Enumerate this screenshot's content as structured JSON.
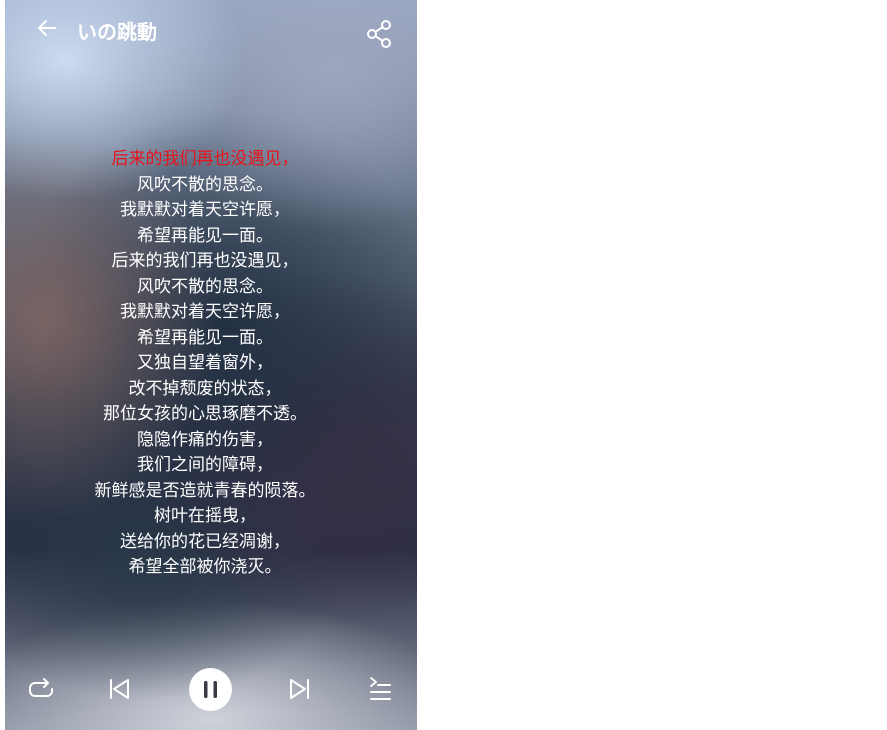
{
  "app": {
    "song_title": "いの跳動"
  },
  "header": {
    "back_icon": "arrow-left-icon",
    "share_icon": "share-icon"
  },
  "lyrics": {
    "active_index": 0,
    "lines": [
      "后来的我们再也没遇见，",
      "风吹不散的思念。",
      "我默默对着天空许愿，",
      "希望再能见一面。",
      "后来的我们再也没遇见，",
      "风吹不散的思念。",
      "我默默对着天空许愿，",
      "希望再能见一面。",
      "又独自望着窗外，",
      "改不掉颓废的状态，",
      "那位女孩的心思琢磨不透。",
      "隐隐作痛的伤害，",
      "我们之间的障碍，",
      "新鲜感是否造就青春的陨落。",
      "树叶在摇曳，",
      "送给你的花已经凋谢，",
      "希望全部被你浇灭。"
    ]
  },
  "controls": {
    "repeat_icon": "repeat-icon",
    "previous_icon": "skip-previous-icon",
    "play_pause_icon": "pause-icon",
    "next_icon": "skip-next-icon",
    "playlist_icon": "playlist-icon"
  },
  "colors": {
    "active_lyric": "#e8141c",
    "lyric": "#ffffff",
    "icon": "#ffffff",
    "play_button_bg": "#ffffff",
    "pause_glyph": "#3a3a44"
  }
}
